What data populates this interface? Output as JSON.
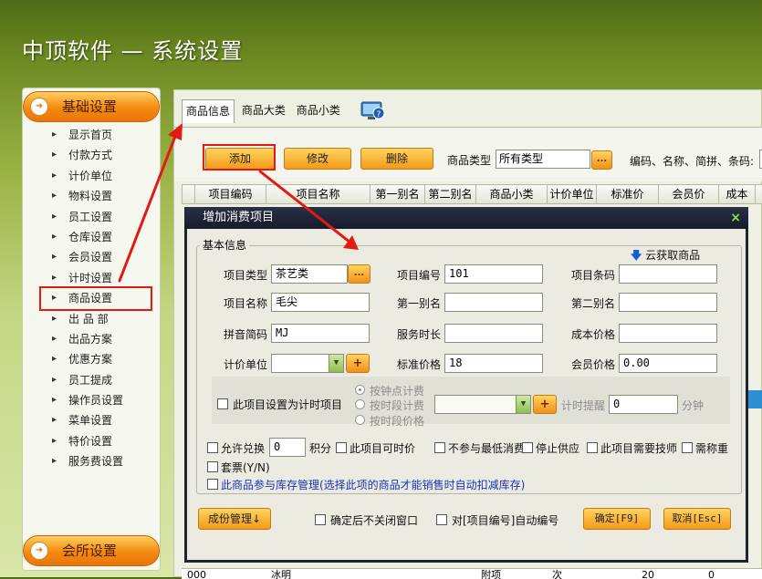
{
  "app": {
    "title": "中顶软件 — 系统设置"
  },
  "sidebar": {
    "section1": "基础设置",
    "items": [
      "显示首页",
      "付款方式",
      "计价单位",
      "物料设置",
      "员工设置",
      "仓库设置",
      "会员设置",
      "计时设置",
      "商品设置",
      "出 品 部",
      "出品方案",
      "优惠方案",
      "员工提成",
      "操作员设置",
      "菜单设置",
      "特价设置",
      "服务费设置"
    ],
    "active_index": 8,
    "section2": "会所设置"
  },
  "tabs": [
    "商品信息",
    "商品大类",
    "商品小类"
  ],
  "toolbar": {
    "add": "添加",
    "edit": "修改",
    "delete": "删除",
    "type_label": "商品类型",
    "type_value": "所有类型",
    "browse": "...",
    "search_label": "编码、名称、简拼、条码:"
  },
  "grid": {
    "columns": [
      "项目编码",
      "项目名称",
      "第一别名",
      "第二别名",
      "商品小类",
      "计价单位",
      "标准价",
      "会员价",
      "成本"
    ],
    "partial_row": [
      "000",
      "冰明",
      "",
      "",
      "附项",
      "次",
      "20",
      "0"
    ]
  },
  "dialog": {
    "title": "增加消费项目",
    "group_label": "基本信息",
    "cloud_fetch": "云获取商品",
    "fields": {
      "item_type_label": "项目类型",
      "item_type_value": "茶艺类",
      "item_code_label": "项目编号",
      "item_code_value": "101",
      "item_barcode_label": "项目条码",
      "item_barcode_value": "",
      "item_name_label": "项目名称",
      "item_name_value": "毛尖",
      "alias1_label": "第一别名",
      "alias1_value": "",
      "alias2_label": "第二别名",
      "alias2_value": "",
      "pinyin_label": "拼音简码",
      "pinyin_value": "MJ",
      "duration_label": "服务时长",
      "duration_value": "",
      "cost_label": "成本价格",
      "cost_value": "",
      "unit_label": "计价单位",
      "unit_value": "",
      "std_price_label": "标准价格",
      "std_price_value": "18",
      "member_price_label": "会员价格",
      "member_price_value": "0.00"
    },
    "timer": {
      "checkbox_label": "此项目设置为计时项目",
      "options": [
        "按钟点计费",
        "按时段计费",
        "按时段价格"
      ],
      "selected_option": "按钟点计费",
      "reminder_label": "计时提醒",
      "reminder_value": "0",
      "reminder_unit": "分钟"
    },
    "options": {
      "exchange_label": "允许兑换",
      "exchange_value": "0",
      "points_unit": "积分",
      "discountable": "此项目可时价",
      "no_min_spend": "不参与最低消费",
      "stop_supply": "停止供应",
      "need_tech": "此项目需要技师",
      "need_weigh": "需称重",
      "set_meal": "套票(Y/N)",
      "inventory": "此商品参与库存管理(选择此项的商品才能销售时自动扣减库存)"
    },
    "footer": {
      "components": "成份管理↓",
      "keep_open": "确定后不关闭窗口",
      "auto_number": "对[项目编号]自动编号",
      "confirm": "确定[F9]",
      "cancel": "取消[Esc]"
    }
  },
  "colors": {
    "accent_orange": "#f49a1a",
    "highlight_red": "#e21a12",
    "title_bar": "#20242e"
  }
}
